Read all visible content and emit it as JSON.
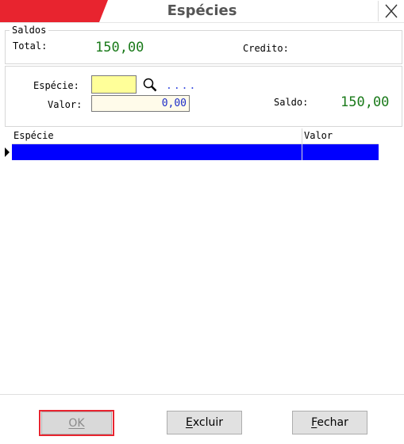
{
  "window": {
    "title": "Espécies",
    "accent_color": "#e8242f",
    "close_icon": "close-icon"
  },
  "saldos": {
    "legend": "Saldos",
    "total_label": "Total:",
    "total_value": "150,00",
    "credito_label": "Credito:"
  },
  "form": {
    "especie_label": "Espécie:",
    "especie_value": "",
    "search_icon": "magnifier-icon",
    "lookup_dots": "....",
    "valor_label": "Valor:",
    "valor_value": "0,00",
    "saldo_label": "Saldo:",
    "saldo_value": "150,00"
  },
  "grid": {
    "columns": [
      "Espécie",
      "Valor"
    ],
    "selected_row_color": "#0000ff",
    "rows": [
      {
        "especie": "",
        "valor": ""
      }
    ]
  },
  "buttons": {
    "ok_label": "OK",
    "excluir_label": "Excluir",
    "fechar_label": "Fechar",
    "focus_color": "#e8242f"
  }
}
